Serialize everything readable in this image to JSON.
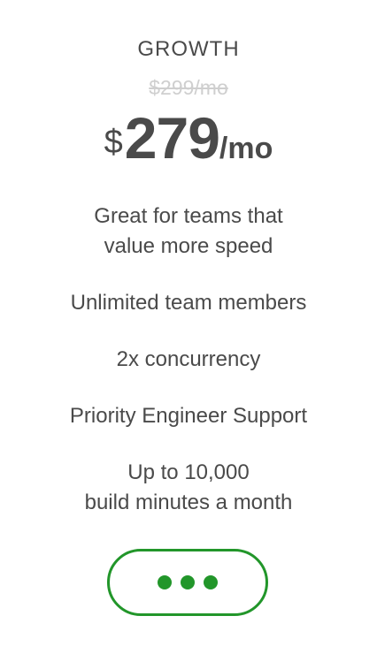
{
  "plan": {
    "name": "GROWTH",
    "old_price": "$299/mo",
    "price": {
      "currency": "$",
      "amount": "279",
      "period": "/mo"
    }
  },
  "features": {
    "description_line1": "Great for teams that",
    "description_line2": "value more speed",
    "members": "Unlimited team members",
    "concurrency": "2x concurrency",
    "support": "Priority Engineer Support",
    "minutes_line1": "Up to 10,000",
    "minutes_line2": "build minutes a month"
  },
  "button": {
    "state": "loading",
    "icon": "ellipsis-icon"
  },
  "colors": {
    "accent": "#22962a",
    "text": "#4a4a4a",
    "muted": "#cfcfcf"
  }
}
